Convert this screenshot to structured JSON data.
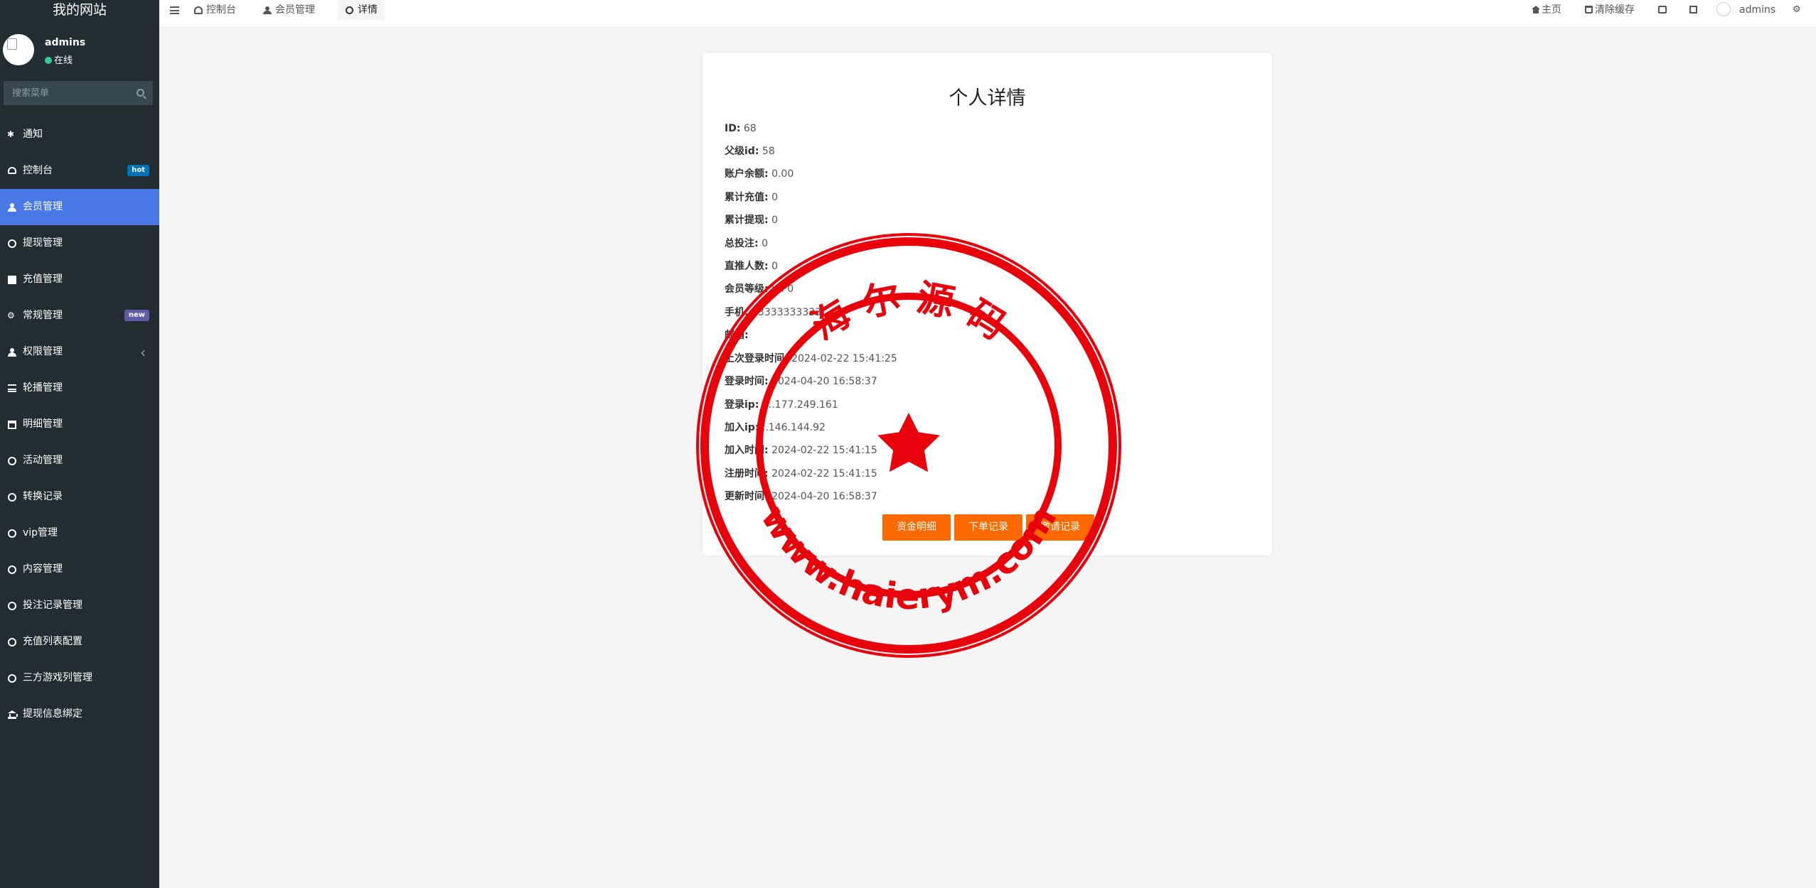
{
  "sidebar": {
    "logo": "我的网站",
    "user": {
      "name": "admins",
      "status": "在线"
    },
    "search_placeholder": "搜索菜单",
    "items": [
      {
        "label": "通知",
        "icon": "asterisk-icon"
      },
      {
        "label": "控制台",
        "icon": "dashboard-icon",
        "badge": "hot"
      },
      {
        "label": "会员管理",
        "icon": "users-icon",
        "active": true
      },
      {
        "label": "提现管理",
        "icon": "circle-icon"
      },
      {
        "label": "充值管理",
        "icon": "grid-icon"
      },
      {
        "label": "常规管理",
        "icon": "cogs-icon",
        "badge": "new"
      },
      {
        "label": "权限管理",
        "icon": "users-icon"
      },
      {
        "label": "轮播管理",
        "icon": "bars-icon"
      },
      {
        "label": "明细管理",
        "icon": "calendar-icon"
      },
      {
        "label": "活动管理",
        "icon": "circle-icon"
      },
      {
        "label": "转换记录",
        "icon": "circle-icon"
      },
      {
        "label": "vip管理",
        "icon": "circle-icon"
      },
      {
        "label": "内容管理",
        "icon": "circle-icon"
      },
      {
        "label": "投注记录管理",
        "icon": "circle-icon"
      },
      {
        "label": "充值列表配置",
        "icon": "circle-icon"
      },
      {
        "label": "三方游戏列管理",
        "icon": "circle-icon"
      },
      {
        "label": "提现信息绑定",
        "icon": "bank-icon"
      }
    ]
  },
  "header": {
    "tabs": [
      {
        "label": "控制台",
        "icon": "dashboard-icon"
      },
      {
        "label": "会员管理",
        "icon": "users-icon"
      },
      {
        "label": "详情",
        "icon": "circle-icon",
        "active": true
      }
    ],
    "home_label": "主页",
    "clear_cache_label": "清除缓存",
    "username": "admins"
  },
  "detail": {
    "title": "个人详情",
    "fields": [
      {
        "key": "ID:",
        "value": "68"
      },
      {
        "key": "父级id:",
        "value": "58"
      },
      {
        "key": "账户余额:",
        "value": "0.00"
      },
      {
        "key": "累计充值:",
        "value": "0"
      },
      {
        "key": "累计提现:",
        "value": "0"
      },
      {
        "key": "总投注:",
        "value": "0"
      },
      {
        "key": "直推人数:",
        "value": "0"
      },
      {
        "key": "会员等级:",
        "value": "VIP0"
      },
      {
        "key": "手机:",
        "value": "13333333333"
      },
      {
        "key": "邮箱:",
        "value": ""
      },
      {
        "key": "上次登录时间:",
        "value": "2024-02-22 15:41:25"
      },
      {
        "key": "登录时间:",
        "value": "2024-04-20 16:58:37"
      },
      {
        "key": "登录ip:",
        "value": "1..177.249.161"
      },
      {
        "key": "加入ip:",
        "value": "..146.144.92"
      },
      {
        "key": "加入时间:",
        "value": "2024-02-22 15:41:15"
      },
      {
        "key": "注册时间:",
        "value": "2024-02-22 15:41:15"
      },
      {
        "key": "更新时间:",
        "value": "2024-04-20 16:58:37"
      }
    ],
    "buttons": [
      "资金明细",
      "下单记录",
      "邀请记录"
    ]
  },
  "stamp": {
    "top_text": "海 尔 源 码",
    "bottom_text": "www.haierym.com",
    "color": "#e8000b"
  }
}
